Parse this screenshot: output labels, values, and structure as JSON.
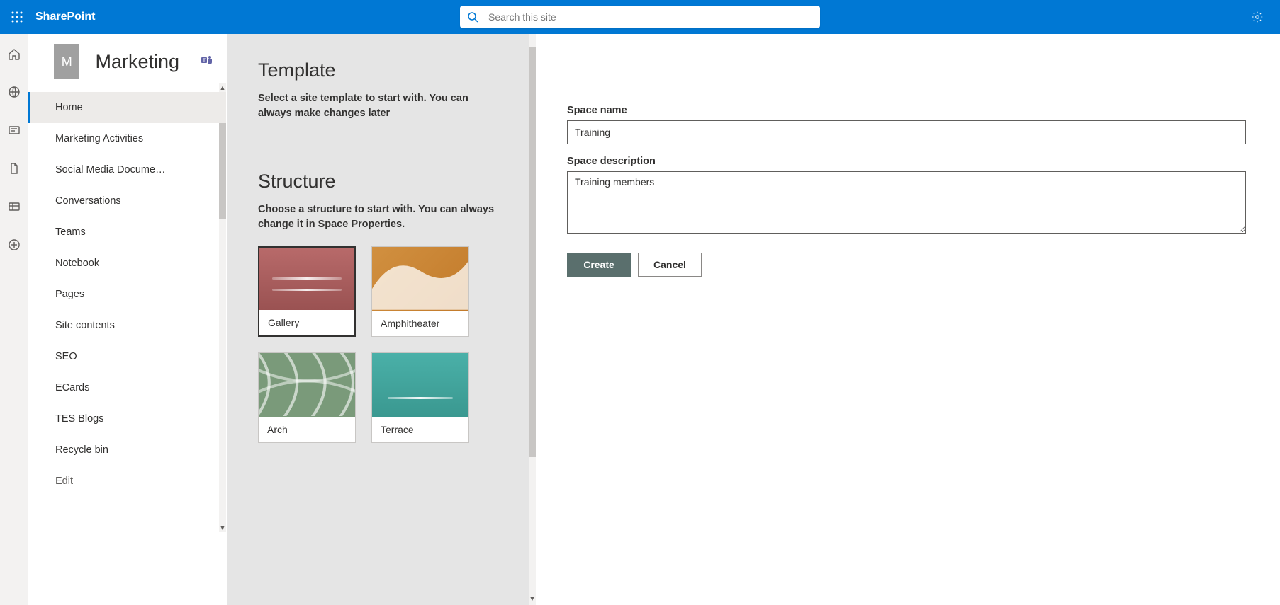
{
  "header": {
    "brand": "SharePoint",
    "search_placeholder": "Search this site"
  },
  "site": {
    "initial": "M",
    "title": "Marketing"
  },
  "nav": {
    "items": [
      {
        "label": "Home",
        "active": true
      },
      {
        "label": "Marketing Activities"
      },
      {
        "label": "Social Media Docume…"
      },
      {
        "label": "Conversations"
      },
      {
        "label": "Teams"
      },
      {
        "label": "Notebook"
      },
      {
        "label": "Pages"
      },
      {
        "label": "Site contents"
      },
      {
        "label": "SEO"
      },
      {
        "label": "ECards"
      },
      {
        "label": "TES Blogs"
      },
      {
        "label": "Recycle bin"
      },
      {
        "label": "Edit",
        "muted": true
      }
    ]
  },
  "template": {
    "heading": "Template",
    "desc": "Select a site template to start with. You can always make changes later",
    "structure_heading": "Structure",
    "structure_desc": "Choose a structure to start with. You can always change it in Space Properties.",
    "structures": [
      {
        "label": "Gallery",
        "selected": true
      },
      {
        "label": "Amphitheater"
      },
      {
        "label": "Arch"
      },
      {
        "label": "Terrace"
      }
    ]
  },
  "form": {
    "name_label": "Space name",
    "name_value": "Training",
    "desc_label": "Space description",
    "desc_value": "Training members",
    "create_label": "Create",
    "cancel_label": "Cancel"
  }
}
